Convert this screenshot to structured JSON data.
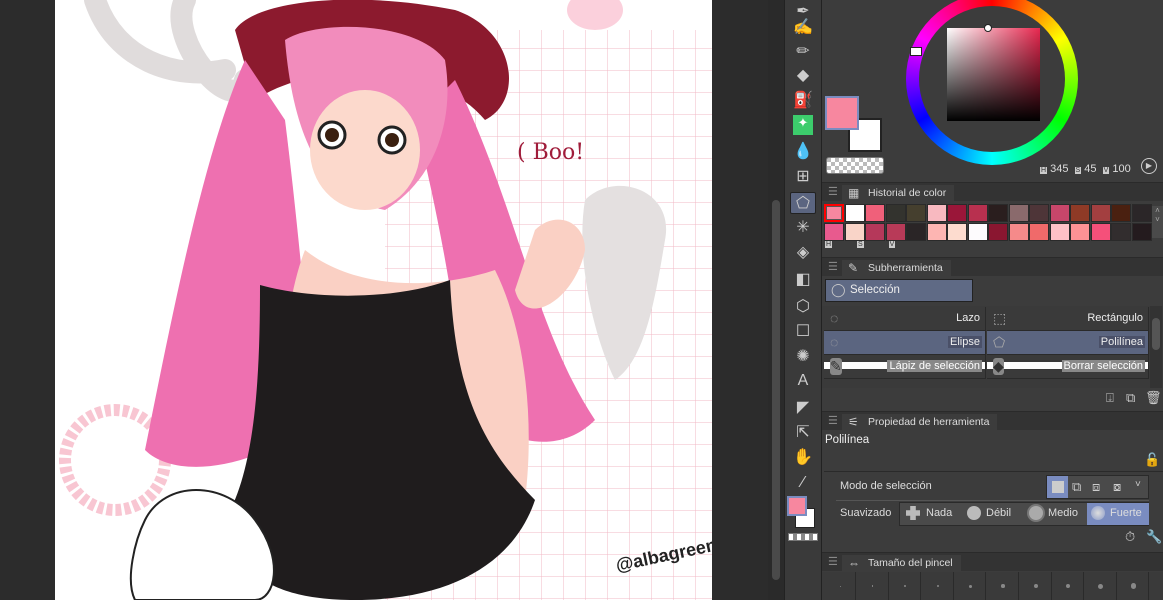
{
  "canvas": {
    "speech_text": "( Boo!",
    "watermark": "@albagreen"
  },
  "color": {
    "main": "#f7879f",
    "sub": "#ffffff",
    "h": "345",
    "s": "45",
    "v": "100",
    "h_label": "H",
    "s_label": "S",
    "v_label": "V"
  },
  "color_history": {
    "title": "Historial de color",
    "hsv_labels": [
      "H",
      "S",
      "V"
    ],
    "row1": [
      "#f7879f",
      "#ffffff",
      "#f0607a",
      "#33332e",
      "#453f2e",
      "#f8b9c0",
      "#9a1639",
      "#b8304f",
      "#2a1e1e",
      "#8a6a6c",
      "#4e3538",
      "#c8466a",
      "#8f3a26",
      "#a33f40",
      "#4a2010",
      "#2b2628"
    ],
    "row2": [
      "#e85a8e",
      "#f9d4c8",
      "#b5385a",
      "#b83a58",
      "#2a2526",
      "#fdb5b2",
      "#fddccf",
      "#fdfbfd",
      "#8a1630",
      "#f58a8a",
      "#f06a6a",
      "#fec0c6",
      "#fd9295",
      "#f5507a",
      "#322d2e",
      "#241b1e"
    ]
  },
  "subtool": {
    "title": "Subherramienta",
    "group": "Selección",
    "items": [
      {
        "label": "Lazo"
      },
      {
        "label": "Rectángulo"
      },
      {
        "label": "Elipse"
      },
      {
        "label": "Polilínea"
      },
      {
        "label": "Lápiz de selección"
      },
      {
        "label": "Borrar selección"
      }
    ]
  },
  "tool_property": {
    "title": "Propiedad de herramienta",
    "tool_name": "Polilínea",
    "selection_mode_label": "Modo de selección",
    "antialias_label": "Suavizado",
    "antialias_options": [
      "Nada",
      "Débil",
      "Medio",
      "Fuerte"
    ],
    "antialias_selected": "Fuerte"
  },
  "brush_size": {
    "title": "Tamaño del pincel"
  }
}
